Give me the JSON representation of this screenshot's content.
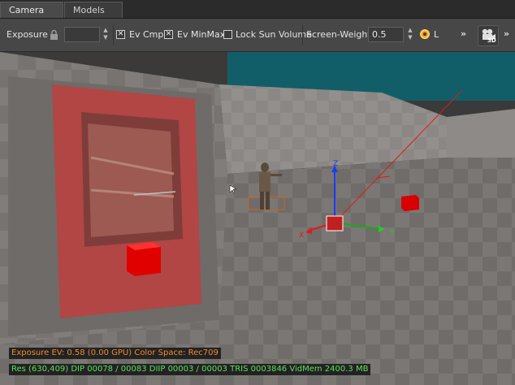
{
  "tabs": [
    {
      "label": "Camera",
      "active": true
    },
    {
      "label": "Models",
      "active": false
    }
  ],
  "toolbar": {
    "exposure_label": "Exposure",
    "exposure_value": "",
    "ev_cmp_label": "Ev Cmp",
    "ev_cmp_checked": true,
    "ev_minmax_label": "Ev MinMax",
    "ev_minmax_checked": true,
    "lock_sun_label": "Lock Sun Volume",
    "lock_sun_checked": false,
    "screen_weight_label": "Screen-Weight",
    "screen_weight_value": "0.5",
    "l_label": "L",
    "camera_mode_badge": "3D"
  },
  "gizmo": {
    "x": "X",
    "y": "Y",
    "z": "Z"
  },
  "hud": {
    "exposure_line": "Exposure EV: 0.58 (0.00 GPU)  Color Space: Rec709",
    "stats_line": "Res (630,409)   DIP 00078 / 00083  DIIP 00003 / 00003  TRIS 0003846  VidMem 2400.3 MB"
  },
  "colors": {
    "accent_orange": "#e07030",
    "hud_green": "#5ee05e",
    "hud_orange": "#f08a30"
  }
}
